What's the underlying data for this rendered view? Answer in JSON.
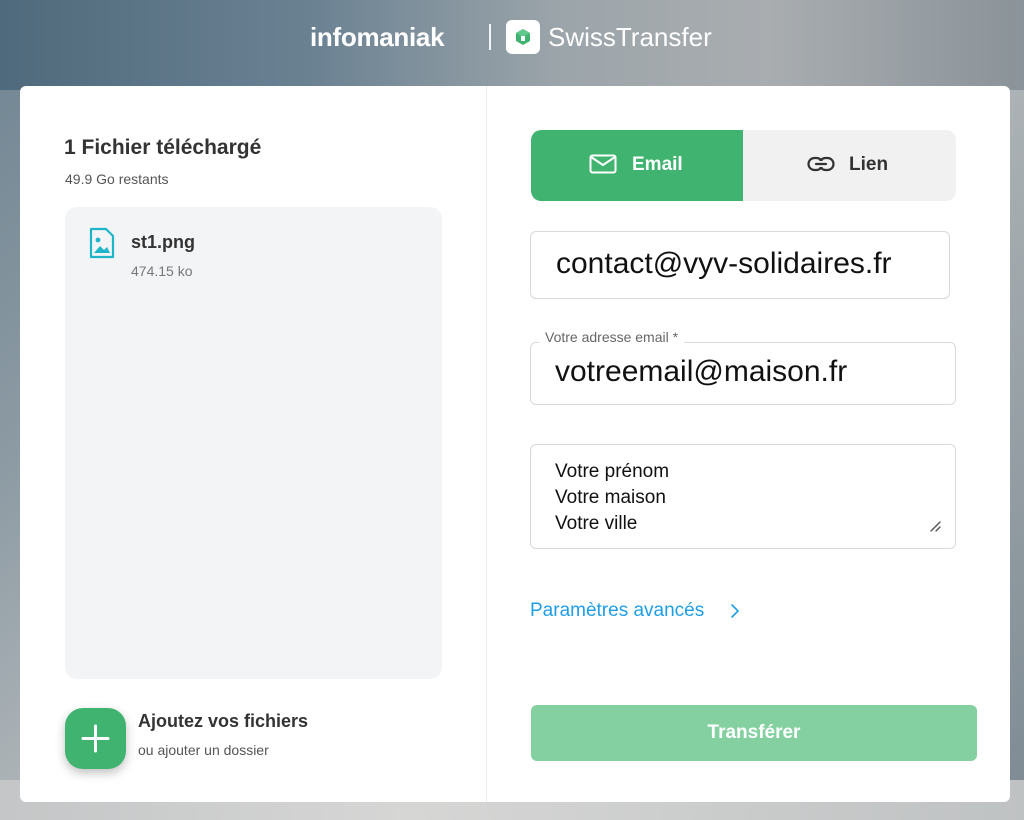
{
  "header": {
    "brand": "infomaniak",
    "product": "SwissTransfer"
  },
  "files": {
    "title": "1 Fichier téléchargé",
    "remaining": "49.9 Go restants",
    "items": [
      {
        "name": "st1.png",
        "size": "474.15 ko",
        "icon": "image-file-icon"
      }
    ]
  },
  "add_files": {
    "label": "Ajoutez vos fichiers",
    "sub_label": "ou ajouter un dossier"
  },
  "tabs": [
    {
      "label": "Email",
      "icon": "mail-icon",
      "active": true
    },
    {
      "label": "Lien",
      "icon": "link-icon",
      "active": false
    }
  ],
  "form": {
    "recipient_value": "contact@vyv-solidaires.fr",
    "sender_label": "Votre adresse email *",
    "sender_value": "votreemail@maison.fr",
    "message_lines": [
      "Votre prénom",
      "Votre maison",
      "Votre ville"
    ]
  },
  "advanced_label": "Paramètres avancés",
  "transfer_label": "Transférer",
  "colors": {
    "accent": "#3fb36f",
    "accent_disabled": "#84d0a1",
    "link": "#1f9ee6"
  }
}
